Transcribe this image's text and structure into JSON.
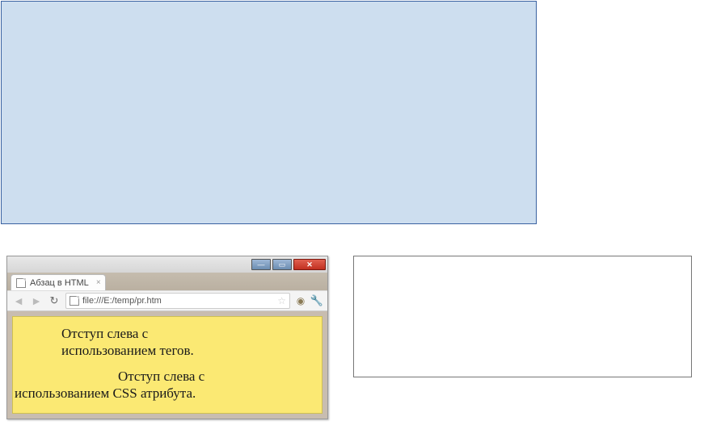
{
  "tab": {
    "title": "Абзац в HTML",
    "close_glyph": "×"
  },
  "nav": {
    "back_glyph": "◄",
    "forward_glyph": "►",
    "reload_glyph": "↻"
  },
  "omnibox": {
    "url": "file:///E:/temp/pr.htm",
    "star_glyph": "☆"
  },
  "tools": {
    "eye_glyph": "◉",
    "wrench_glyph": "🔧"
  },
  "titlebar": {
    "min_glyph": "—",
    "max_glyph": "▭",
    "close_glyph": "✕"
  },
  "content": {
    "p1_line1": "Отступ слева с",
    "p1_line2": "использованием тегов.",
    "p2_line1": "Отступ слева с",
    "p2_line2": "использованием CSS атрибута."
  }
}
